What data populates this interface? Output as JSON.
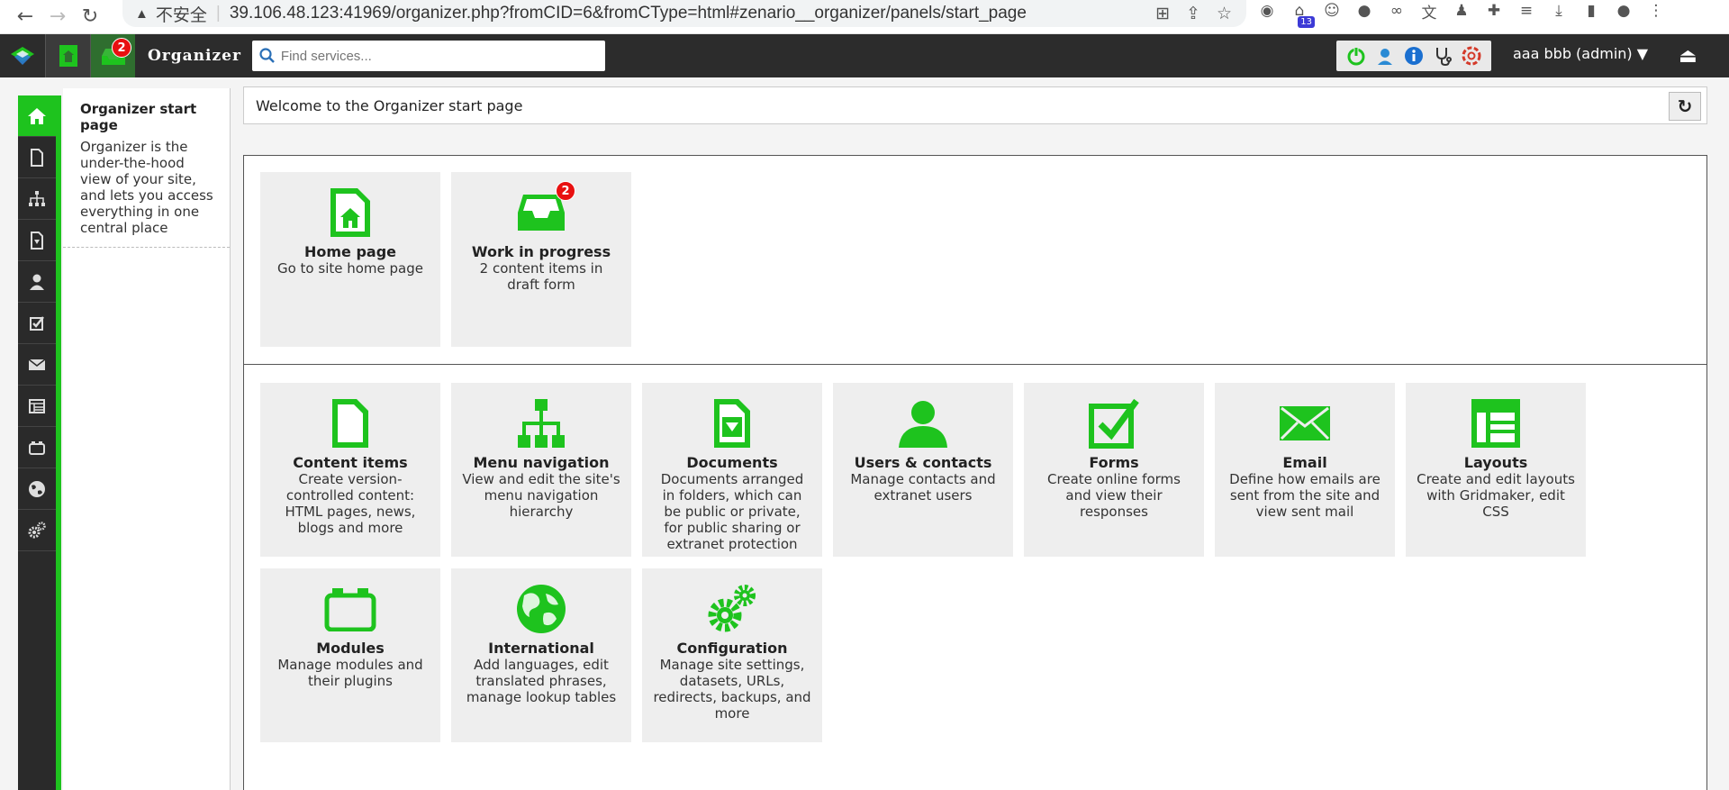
{
  "browser": {
    "security_warning": "不安全",
    "url": "39.106.48.123:41969/organizer.php?fromCID=6&fromCType=html#zenario__organizer/panels/start_page",
    "extension_badge": "13"
  },
  "topbar": {
    "brand": "Organizer",
    "search_placeholder": "Find services...",
    "work_badge": "2",
    "user_label": "aaa bbb (admin) ▼"
  },
  "info_panel": {
    "title": "Organizer start page",
    "description": "Organizer is the under-the-hood view of your site, and lets you access everything in one central place"
  },
  "welcome": {
    "text": "Welcome to the Organizer start page"
  },
  "quick_tiles": [
    {
      "title": "Home page",
      "desc": "Go to site home page"
    },
    {
      "title": "Work in progress",
      "desc": "2 content items in draft form",
      "badge": "2"
    }
  ],
  "service_tiles": [
    {
      "title": "Content items",
      "desc": "Create version-controlled content: HTML pages, news, blogs and more"
    },
    {
      "title": "Menu navigation",
      "desc": "View and edit the site's menu navigation hierarchy"
    },
    {
      "title": "Documents",
      "desc": "Documents arranged in folders, which can be public or private, for public sharing or extranet protection"
    },
    {
      "title": "Users & contacts",
      "desc": "Manage contacts and extranet users"
    },
    {
      "title": "Forms",
      "desc": "Create online forms and view their responses"
    },
    {
      "title": "Email",
      "desc": "Define how emails are sent from the site and view sent mail"
    },
    {
      "title": "Layouts",
      "desc": "Create and edit layouts with Gridmaker, edit CSS"
    },
    {
      "title": "Modules",
      "desc": "Manage modules and their plugins"
    },
    {
      "title": "International",
      "desc": "Add languages, edit translated phrases, manage lookup tables"
    },
    {
      "title": "Configuration",
      "desc": "Manage site settings, datasets, URLs, redirects, backups, and more"
    }
  ],
  "colors": {
    "accent": "#1ec31e",
    "badge": "#e81010",
    "topbar": "#2c2c2c"
  }
}
